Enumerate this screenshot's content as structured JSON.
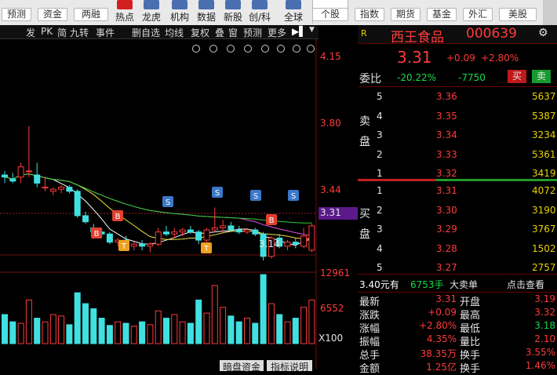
{
  "toolbar": {
    "row_buttons": [
      "预测",
      "资金",
      "两融"
    ],
    "icons": [
      {
        "name": "hot-icon",
        "label": "热点"
      },
      {
        "name": "dragon-icon",
        "label": "龙虎"
      },
      {
        "name": "institution-icon",
        "label": "机构"
      },
      {
        "name": "data-icon",
        "label": "数据"
      },
      {
        "name": "new-stock-icon",
        "label": "新股"
      },
      {
        "name": "innovation-icon",
        "label": "创/科"
      },
      {
        "name": "global-icon",
        "label": "全球"
      }
    ],
    "right_buttons": [
      "个股",
      "指数",
      "期货",
      "基金",
      "外汇",
      "美股"
    ],
    "accent": "#d22020"
  },
  "chart_toolbar": [
    "发",
    "PK",
    "简",
    "九转",
    "事件",
    "删自选",
    "均线",
    "复权",
    "叠",
    "窗",
    "预测",
    "更多"
  ],
  "stock": {
    "indicator": "R",
    "name": "西王食品",
    "code": "000639",
    "price": "3.31",
    "change": "+0.09",
    "pct": "+2.80%"
  },
  "weibi": {
    "label": "委比",
    "pct": "-20.22%",
    "diff": "-7750",
    "sell": "买",
    "buy": "卖"
  },
  "sell_label": "卖盘",
  "buy_label": "买盘",
  "asks": [
    {
      "lvl": "5",
      "price": "3.36",
      "vol": "5637"
    },
    {
      "lvl": "4",
      "price": "3.35",
      "vol": "5387"
    },
    {
      "lvl": "3",
      "price": "3.34",
      "vol": "3234"
    },
    {
      "lvl": "2",
      "price": "3.33",
      "vol": "5361"
    },
    {
      "lvl": "1",
      "price": "3.32",
      "vol": "3419"
    }
  ],
  "bids": [
    {
      "lvl": "1",
      "price": "3.31",
      "vol": "4072"
    },
    {
      "lvl": "2",
      "price": "3.30",
      "vol": "3190"
    },
    {
      "lvl": "3",
      "price": "3.29",
      "vol": "3767"
    },
    {
      "lvl": "4",
      "price": "3.28",
      "vol": "1502"
    },
    {
      "lvl": "5",
      "price": "3.27",
      "vol": "2757"
    }
  ],
  "big_order": {
    "price": "3.40元有",
    "vol": "6753手",
    "type": "大卖单",
    "link": "点击查看"
  },
  "quote": [
    {
      "l1": "最新",
      "v1": "3.31",
      "l2": "开盘",
      "v2": "3.19"
    },
    {
      "l1": "涨跌",
      "v1": "+0.09",
      "l2": "最高",
      "v2": "3.32"
    },
    {
      "l1": "涨幅",
      "v1": "+2.80%",
      "l2": "最低",
      "v2": "3.18"
    },
    {
      "l1": "振幅",
      "v1": "4.35%",
      "l2": "量比",
      "v2": "2.10"
    },
    {
      "l1": "总手",
      "v1": "38.35万",
      "l2": "换手",
      "v2": "3.55%"
    },
    {
      "l1": "金额",
      "v1": "1.25亿",
      "l2": "换手",
      "v2": "1.46%"
    }
  ],
  "price_axis": [
    "4.15",
    "3.80",
    "3.44",
    "3.31"
  ],
  "vol_axis": [
    "12961",
    "6552",
    "X100"
  ],
  "low_mark": "3.14",
  "bottom_tabs": [
    "暗盘资金",
    "指标说明"
  ],
  "chart_data": {
    "type": "candlestick",
    "current_price": 3.31,
    "ylim": [
      3.0,
      4.2
    ],
    "ohlc": [
      [
        3.56,
        3.58,
        3.52,
        3.55
      ],
      [
        3.54,
        3.57,
        3.52,
        3.53
      ],
      [
        3.55,
        3.62,
        3.52,
        3.6
      ],
      [
        3.58,
        3.8,
        3.55,
        3.58
      ],
      [
        3.56,
        3.62,
        3.5,
        3.52
      ],
      [
        3.5,
        3.55,
        3.48,
        3.5
      ],
      [
        3.48,
        3.5,
        3.46,
        3.49
      ],
      [
        3.49,
        3.51,
        3.47,
        3.5
      ],
      [
        3.5,
        3.51,
        3.47,
        3.48
      ],
      [
        3.48,
        3.49,
        3.35,
        3.36
      ],
      [
        3.36,
        3.38,
        3.32,
        3.33
      ],
      [
        3.3,
        3.32,
        3.27,
        3.28
      ],
      [
        3.28,
        3.3,
        3.25,
        3.27
      ],
      [
        3.27,
        3.28,
        3.22,
        3.23
      ],
      [
        3.23,
        3.25,
        3.21,
        3.24
      ],
      [
        3.24,
        3.26,
        3.2,
        3.21
      ],
      [
        3.21,
        3.23,
        3.19,
        3.22
      ],
      [
        3.22,
        3.24,
        3.19,
        3.21
      ],
      [
        3.21,
        3.23,
        3.18,
        3.22
      ],
      [
        3.22,
        3.3,
        3.21,
        3.28
      ],
      [
        3.28,
        3.31,
        3.26,
        3.27
      ],
      [
        3.27,
        3.3,
        3.25,
        3.28
      ],
      [
        3.28,
        3.3,
        3.26,
        3.29
      ],
      [
        3.29,
        3.31,
        3.27,
        3.28
      ],
      [
        3.28,
        3.29,
        3.22,
        3.24
      ],
      [
        3.24,
        3.3,
        3.23,
        3.29
      ],
      [
        3.29,
        3.4,
        3.28,
        3.3
      ],
      [
        3.3,
        3.34,
        3.28,
        3.31
      ],
      [
        3.31,
        3.33,
        3.28,
        3.29
      ],
      [
        3.29,
        3.31,
        3.27,
        3.28
      ],
      [
        3.28,
        3.3,
        3.27,
        3.29
      ],
      [
        3.29,
        3.3,
        3.26,
        3.27
      ],
      [
        3.27,
        3.28,
        3.14,
        3.16
      ],
      [
        3.16,
        3.26,
        3.15,
        3.25
      ],
      [
        3.25,
        3.27,
        3.2,
        3.21
      ],
      [
        3.21,
        3.24,
        3.19,
        3.23
      ],
      [
        3.23,
        3.25,
        3.2,
        3.22
      ],
      [
        3.21,
        3.3,
        3.2,
        3.26
      ],
      [
        3.19,
        3.32,
        3.18,
        3.31
      ]
    ],
    "volume": [
      40,
      30,
      28,
      60,
      35,
      30,
      40,
      38,
      26,
      70,
      55,
      48,
      35,
      25,
      30,
      28,
      24,
      30,
      26,
      45,
      35,
      40,
      30,
      28,
      60,
      42,
      80,
      50,
      38,
      30,
      35,
      28,
      95,
      55,
      40,
      30,
      35,
      50,
      60
    ]
  }
}
